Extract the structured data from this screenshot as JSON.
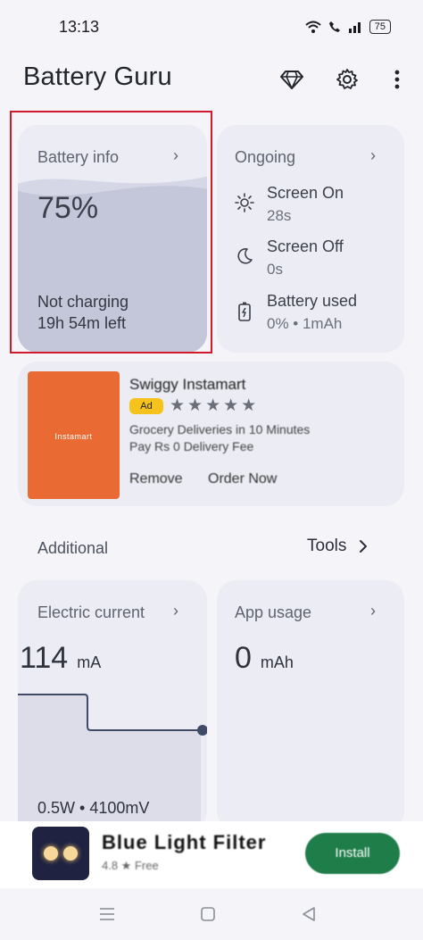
{
  "status_bar": {
    "time": "13:13",
    "battery": "75"
  },
  "app": {
    "title": "Battery Guru"
  },
  "battery_info": {
    "title": "Battery info",
    "percent": "75%",
    "level": 0.75,
    "state": "Not charging",
    "time_left": "19h 54m left"
  },
  "ongoing": {
    "title": "Ongoing",
    "rows": [
      {
        "label": "Screen On",
        "value": "28s",
        "icon": "sun-icon"
      },
      {
        "label": "Screen Off",
        "value": "0s",
        "icon": "moon-icon"
      },
      {
        "label": "Battery used",
        "value": "0% • 1mAh",
        "icon": "battery-charge-icon"
      }
    ]
  },
  "ad": {
    "title": "Swiggy Instamart",
    "badge": "Ad",
    "image_text": "Instamart",
    "description_1": "Grocery Deliveries in 10 Minutes",
    "description_2": "Pay Rs 0 Delivery Fee",
    "remove": "Remove",
    "order": "Order Now"
  },
  "section": {
    "label": "Additional",
    "tools": "Tools"
  },
  "electric_current": {
    "title": "Electric current",
    "value": "114",
    "unit": "mA",
    "power": "0.5W • 4100mV"
  },
  "app_usage": {
    "title": "App usage",
    "value": "0",
    "unit": "mAh"
  },
  "banner_ad": {
    "title": "Blue Light Filter",
    "subtitle": "4.8 ★  Free",
    "install": "Install"
  },
  "colors": {
    "battery_fill": "#c4c6d9",
    "accent_highlight": "#d11b2b",
    "ad_orange": "#ea6a34",
    "install_green": "#1f7d4a"
  }
}
